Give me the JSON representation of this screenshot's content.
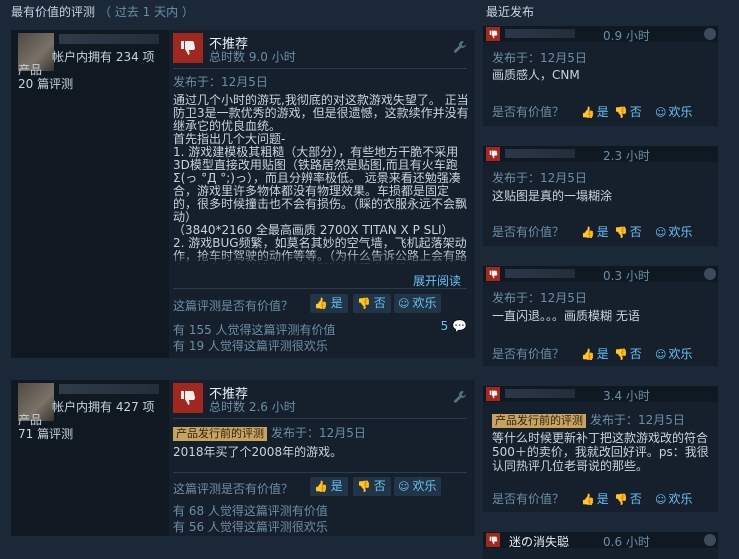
{
  "left_section": {
    "title": "最有价值的评测",
    "range": "（ 过去 1 天内 ）"
  },
  "right_section": {
    "title": "最近发布"
  },
  "reviews": [
    {
      "owns": "帐户内拥有 234 项",
      "products_label": "产品",
      "review_count": "20 篇评测",
      "rec": "不推荐",
      "hours": "总时数 9.0 小时",
      "posted": "发布于：12月5日",
      "prerelease": "",
      "body": "通过几个小时的游玩,我彻底的对这款游戏失望了。 正当防卫3是一款优秀的游戏，但是很遗憾，这款续作并没有继承它的优良血统。\n首先指出几个大问题-\n1. 游戏建模极其粗糙（大部分），有些地方干脆不采用3D模型直接改用贴图（铁路居然是贴图,而且有火车跑Σ(っ °Д °;)っ），而且分辨率极低。 远景来看还勉强凑合，游戏里许多物体都没有物理效果。车损都是固定的，很多时候撞击也不会有损伤。（睬的衣服永远不会飘动）\n（3840*2160 全最高画质 2700X TITAN X P SLI）\n2. 游戏BUG频繁，如莫名其妙的空气墙，飞机起落架动作，抢车时驾驶的动作等等。（为什么告诉公路上会有路人，来车会主动撞你。）在辅助的过程中间操头",
      "expand": "展开阅读",
      "helpful_q": "这篇评测是否有价值？",
      "yes": "是",
      "no": "否",
      "funny": "欢乐",
      "stat1": "有 155 人觉得这篇评测有价值",
      "stat2": "有 19 人觉得这篇评测很欢乐",
      "comments": "5"
    },
    {
      "owns": "帐户内拥有 427 项",
      "products_label": "产品",
      "review_count": "71 篇评测",
      "rec": "不推荐",
      "hours": "总时数 2.6 小时",
      "posted": "发布于：12月5日",
      "prerelease": "产品发行前的评测",
      "body": "2018年买了个2008年的游戏。",
      "expand": "",
      "helpful_q": "这篇评测是否有价值？",
      "yes": "是",
      "no": "否",
      "funny": "欢乐",
      "stat1": "有 68 人觉得这篇评测有价值",
      "stat2": "有 56 人觉得这篇评测很欢乐",
      "comments": ""
    }
  ],
  "recent": [
    {
      "name": "",
      "hours": "0.9 小时",
      "posted": "发布于：12月5日",
      "prerelease": "",
      "text": "画质感人，CNM",
      "helpful_q": "是否有价值？",
      "yes": "是",
      "no": "否",
      "funny": "欢乐"
    },
    {
      "name": "",
      "hours": "2.3 小时",
      "posted": "发布于：12月5日",
      "prerelease": "",
      "text": "这贴图是真的一塌糊涂",
      "helpful_q": "是否有价值？",
      "yes": "是",
      "no": "否",
      "funny": "欢乐"
    },
    {
      "name": "",
      "hours": "0.3 小时",
      "posted": "发布于：12月5日",
      "prerelease": "",
      "text": "一直闪退。。。画质模糊 无语",
      "helpful_q": "是否有价值？",
      "yes": "是",
      "no": "否",
      "funny": "欢乐"
    },
    {
      "name": "",
      "hours": "3.4 小时",
      "posted": "发布于：12月5日",
      "prerelease": "产品发行前的评测",
      "text": "等什么时候更新补丁把这款游戏改的符合500＋的卖价，我就改回好评。ps：我很认同热评几位老哥说的那些。",
      "helpful_q": "是否有价值？",
      "yes": "是",
      "no": "否",
      "funny": "欢乐"
    },
    {
      "name": "迷の消失聪",
      "hours": "0.6 小时",
      "posted": "",
      "prerelease": "",
      "text": "",
      "helpful_q": "",
      "yes": "",
      "no": "",
      "funny": ""
    }
  ],
  "colors": {
    "bg": "#1b2838",
    "card": "#16202d",
    "thumb_down": "#a2271e",
    "link": "#67c1f5",
    "muted": "#6a8fa6",
    "prerelease": "#c8a35d"
  }
}
